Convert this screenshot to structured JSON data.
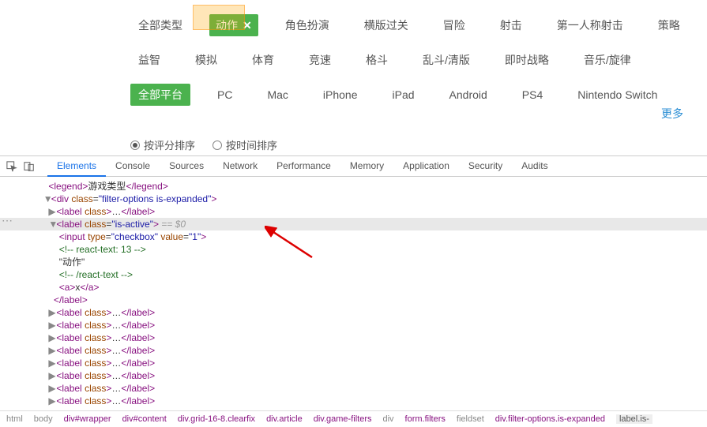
{
  "filters": {
    "type_row": [
      "全部类型",
      "动作",
      "角色扮演",
      "横版过关",
      "冒险",
      "射击",
      "第一人称射击",
      "策略"
    ],
    "type_row2": [
      "益智",
      "模拟",
      "体育",
      "竞速",
      "格斗",
      "乱斗/清版",
      "即时战略",
      "音乐/旋律"
    ],
    "active_type_index": 1,
    "platform_row": [
      "全部平台",
      "PC",
      "Mac",
      "iPhone",
      "iPad",
      "Android",
      "PS4",
      "Nintendo Switch"
    ],
    "active_platform_index": 0,
    "more": "更多"
  },
  "sort": {
    "opt1": "按评分排序",
    "opt2": "按时间排序",
    "selected": 0
  },
  "devtools": {
    "tabs": [
      "Elements",
      "Console",
      "Sources",
      "Network",
      "Performance",
      "Memory",
      "Application",
      "Security",
      "Audits"
    ],
    "active_tab": 0,
    "legend_open": "<legend>",
    "legend_text": "游戏类型",
    "legend_close": "</legend>",
    "div_filter": "<div class=\"filter-options is-expanded\">",
    "label_collapsed": "<label class>…</label>",
    "label_active_open": "<label class=\"is-active\">",
    "eq0": " == $0",
    "input_line": "<input type=\"checkbox\" value=\"1\">",
    "react_open": "<!-- react-text: 13 -->",
    "text_dongzuo": "\"动作\"",
    "react_close": "<!-- /react-text -->",
    "a_line": "<a>x</a>",
    "label_close": "</label>"
  },
  "breadcrumb": [
    "html",
    "body",
    "div#wrapper",
    "div#content",
    "div.grid-16-8.clearfix",
    "div.article",
    "div.game-filters",
    "div",
    "form.filters",
    "fieldset",
    "div.filter-options.is-expanded",
    "label.is-"
  ]
}
